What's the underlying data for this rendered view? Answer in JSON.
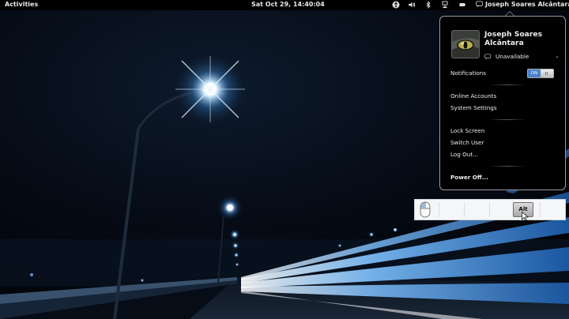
{
  "top_bar": {
    "activities_label": "Activities",
    "clock": "Sat Oct 29, 14:40:04",
    "user_name": "Joseph Soares Alcântara",
    "tray_icons": [
      "accessibility-icon",
      "volume-icon",
      "bluetooth-icon",
      "network-icon",
      "battery-icon",
      "chat-icon"
    ]
  },
  "user_menu": {
    "user_name": "Joseph Soares Alcântara",
    "status": "Unavailable",
    "notifications_label": "Notifications",
    "notifications_state": "ON",
    "online_accounts": "Online Accounts",
    "system_settings": "System Settings",
    "lock_screen": "Lock Screen",
    "switch_user": "Switch User",
    "log_out": "Log Out...",
    "power_off": "Power Off..."
  },
  "key_display": {
    "active_key": "Alt",
    "pressed_button": "left-mouse-button"
  },
  "colors": {
    "panel_bg": "#000000",
    "toggle_on": "#4b82c8",
    "wallpaper_glow": "#bfe4ff",
    "light_streak": "#3f8fe0"
  }
}
